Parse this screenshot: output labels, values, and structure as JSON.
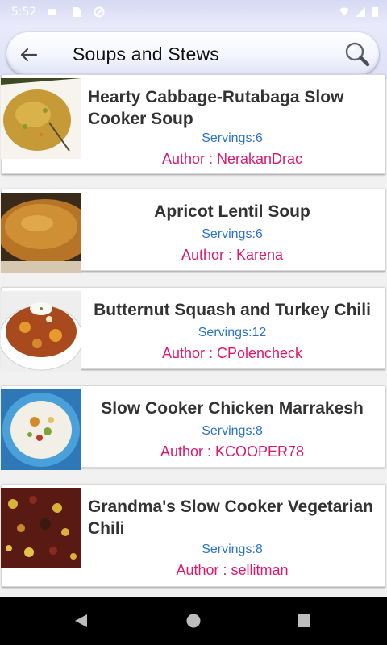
{
  "status_bar": {
    "time": "5:52"
  },
  "header": {
    "title": "Soups and Stews"
  },
  "recipes": [
    {
      "title": "Hearty Cabbage-Rutabaga Slow Cooker Soup",
      "servings": "Servings:6",
      "author": "Author : NerakanDrac"
    },
    {
      "title": "Apricot Lentil Soup",
      "servings": "Servings:6",
      "author": "Author : Karena"
    },
    {
      "title": "Butternut Squash and Turkey Chili",
      "servings": "Servings:12",
      "author": "Author : CPolencheck"
    },
    {
      "title": "Slow Cooker Chicken Marrakesh",
      "servings": "Servings:8",
      "author": "Author : KCOOPER78"
    },
    {
      "title": "Grandma's Slow Cooker Vegetarian Chili",
      "servings": "Servings:8",
      "author": "Author : sellitman"
    }
  ],
  "icons": {
    "back": "arrow-left-icon",
    "search": "magnifier-icon",
    "nav_back": "triangle-back-icon",
    "nav_home": "circle-home-icon",
    "nav_recents": "square-recents-icon"
  },
  "colors": {
    "servings": "#2a73c8",
    "author": "#e3176a",
    "header_bg": "#e9eafa"
  }
}
